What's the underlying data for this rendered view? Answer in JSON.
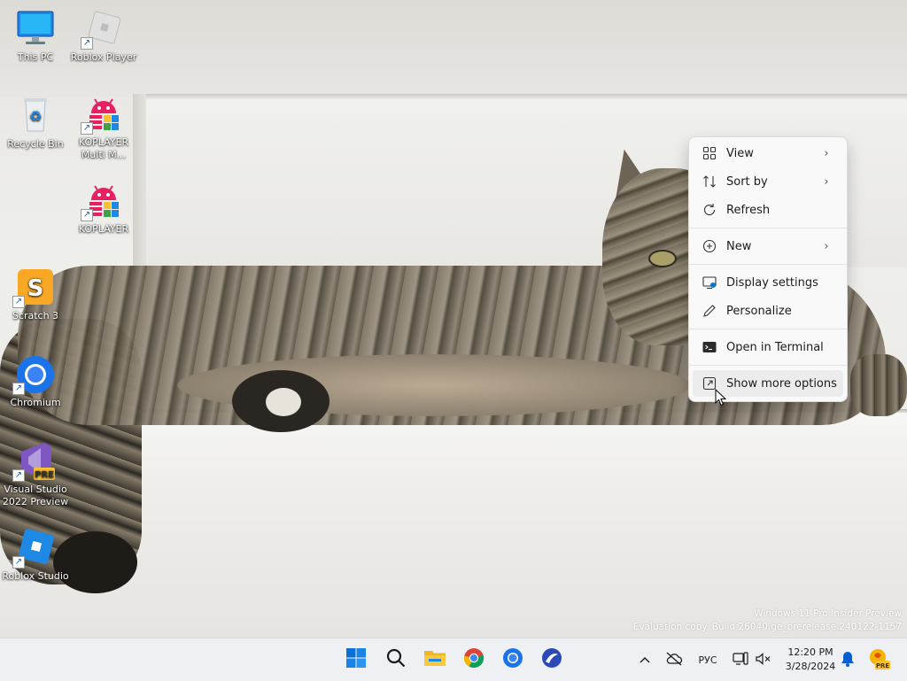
{
  "desktop": {
    "icons": [
      {
        "label": "This PC",
        "icon": "monitor-icon"
      },
      {
        "label": "Roblox Player",
        "icon": "roblox-player-icon"
      },
      {
        "label": "Recycle Bin",
        "icon": "recycle-bin-icon"
      },
      {
        "label": "KOPLAYER Multi M...",
        "icon": "koplayer-icon"
      },
      {
        "label": "KOPLAYER",
        "icon": "koplayer-icon"
      },
      {
        "label": "Scratch 3",
        "icon": "scratch-icon"
      },
      {
        "label": "Chromium",
        "icon": "chromium-icon"
      },
      {
        "label": "Visual Studio 2022 Preview",
        "icon": "visual-studio-icon"
      },
      {
        "label": "Roblox Studio",
        "icon": "roblox-studio-icon"
      }
    ]
  },
  "context_menu": {
    "items": [
      {
        "label": "View",
        "icon": "view-grid-icon",
        "submenu": true
      },
      {
        "label": "Sort by",
        "icon": "sort-icon",
        "submenu": true
      },
      {
        "label": "Refresh",
        "icon": "refresh-icon",
        "submenu": false
      },
      {
        "label": "New",
        "icon": "new-plus-icon",
        "submenu": true
      },
      {
        "label": "Display settings",
        "icon": "display-settings-icon",
        "submenu": false
      },
      {
        "label": "Personalize",
        "icon": "pen-icon",
        "submenu": false
      },
      {
        "label": "Open in Terminal",
        "icon": "terminal-icon",
        "submenu": false
      },
      {
        "label": "Show more options",
        "icon": "show-more-icon",
        "submenu": false
      }
    ],
    "submenu_glyph": "›"
  },
  "watermark": {
    "line1": "Windows 11 Pro Insider Preview",
    "line2": "Evaluation copy. Build 26040.ge_prerelease.240122-1157"
  },
  "taskbar": {
    "apps": [
      "start-icon",
      "search-icon",
      "file-explorer-icon",
      "chrome-icon",
      "chromium-icon",
      "roblox-studio-icon"
    ],
    "tray": {
      "chevron": "^",
      "language": "РУС"
    },
    "clock": {
      "time": "12:20 PM",
      "date": "3/28/2024"
    }
  },
  "colors": {
    "menu_bg": "#f9f9f9",
    "taskbar_bg": "#eef0f3",
    "win_blue": "#0078d4"
  }
}
